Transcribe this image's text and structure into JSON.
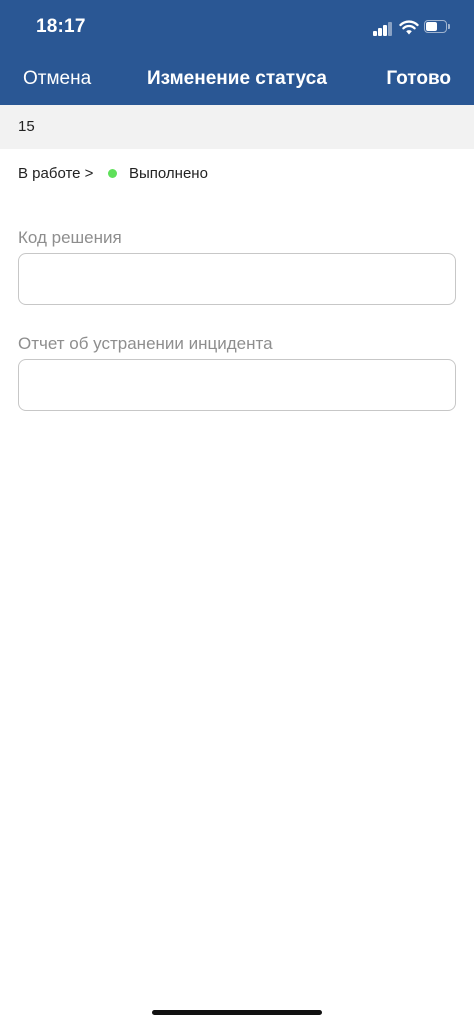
{
  "status_bar": {
    "time": "18:17",
    "icons": [
      "cellular-signal-icon",
      "wifi-icon",
      "battery-icon"
    ]
  },
  "nav": {
    "cancel_label": "Отмена",
    "title": "Изменение статуса",
    "done_label": "Готово"
  },
  "incident": {
    "number": "15"
  },
  "status_change": {
    "from": "В работе >",
    "to": "Выполнено",
    "to_color": "#5fe05a"
  },
  "fields": {
    "resolution_code": {
      "label": "Код решения",
      "value": ""
    },
    "resolution_report": {
      "label": "Отчет об устранении инцидента",
      "value": ""
    }
  },
  "colors": {
    "header_bg": "#2a5794",
    "row_bg": "#f2f2f2",
    "label_gray": "#8e8e8e"
  }
}
